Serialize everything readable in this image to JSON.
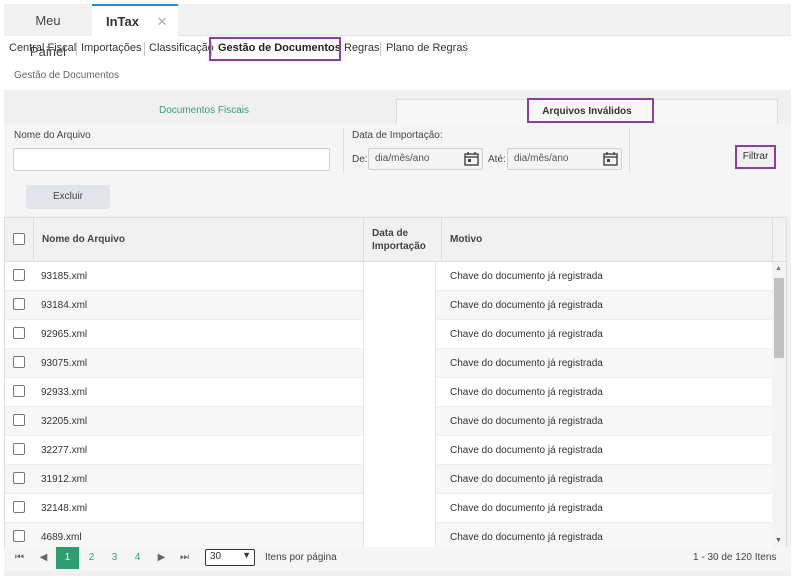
{
  "window_tabs": [
    {
      "label": "Meu Painel"
    },
    {
      "label": "InTax"
    }
  ],
  "nav": [
    {
      "label": "Central Fiscal"
    },
    {
      "label": "Importações"
    },
    {
      "label": "Classificação"
    },
    {
      "label": "Gestão de Documentos"
    },
    {
      "label": "Regras"
    },
    {
      "label": "Plano de Regras"
    }
  ],
  "breadcrumb": "Gestão de Documentos",
  "subtabs": {
    "fiscal": "Documentos Fiscais",
    "invalid": "Arquivos Inválidos"
  },
  "filters": {
    "file_name_label": "Nome do Arquivo",
    "file_name_value": "",
    "import_date_label": "Data de Importação:",
    "from_label": "De:",
    "from_value": "dia/mês/ano",
    "to_label": "Até:",
    "to_value": "dia/mês/ano",
    "filter_button": "Filtrar"
  },
  "delete_button": "Excluir",
  "grid": {
    "headers": {
      "file": "Nome do Arquivo",
      "date_line1": "Data de",
      "date_line2": "Importação",
      "reason": "Motivo"
    },
    "rows": [
      {
        "file": "93185.xml",
        "date": "",
        "reason": "Chave do documento já registrada"
      },
      {
        "file": "93184.xml",
        "date": "",
        "reason": "Chave do documento já registrada"
      },
      {
        "file": "92965.xml",
        "date": "",
        "reason": "Chave do documento já registrada"
      },
      {
        "file": "93075.xml",
        "date": "",
        "reason": "Chave do documento já registrada"
      },
      {
        "file": "92933.xml",
        "date": "",
        "reason": "Chave do documento já registrada"
      },
      {
        "file": "32205.xml",
        "date": "",
        "reason": "Chave do documento já registrada"
      },
      {
        "file": "32277.xml",
        "date": "",
        "reason": "Chave do documento já registrada"
      },
      {
        "file": "31912.xml",
        "date": "",
        "reason": "Chave do documento já registrada"
      },
      {
        "file": "32148.xml",
        "date": "",
        "reason": "Chave do documento já registrada"
      },
      {
        "file": "4689.xml",
        "date": "",
        "reason": "Chave do documento já registrada"
      }
    ]
  },
  "pager": {
    "pages": [
      "1",
      "2",
      "3",
      "4"
    ],
    "current_page": "1",
    "page_size": "30",
    "per_page_label": "Itens por página",
    "summary": "1 - 30 de 120 Itens"
  },
  "colors": {
    "accent": "#2e9d6f",
    "highlight": "#8e3ea2",
    "tab_top": "#1b8fd8"
  }
}
